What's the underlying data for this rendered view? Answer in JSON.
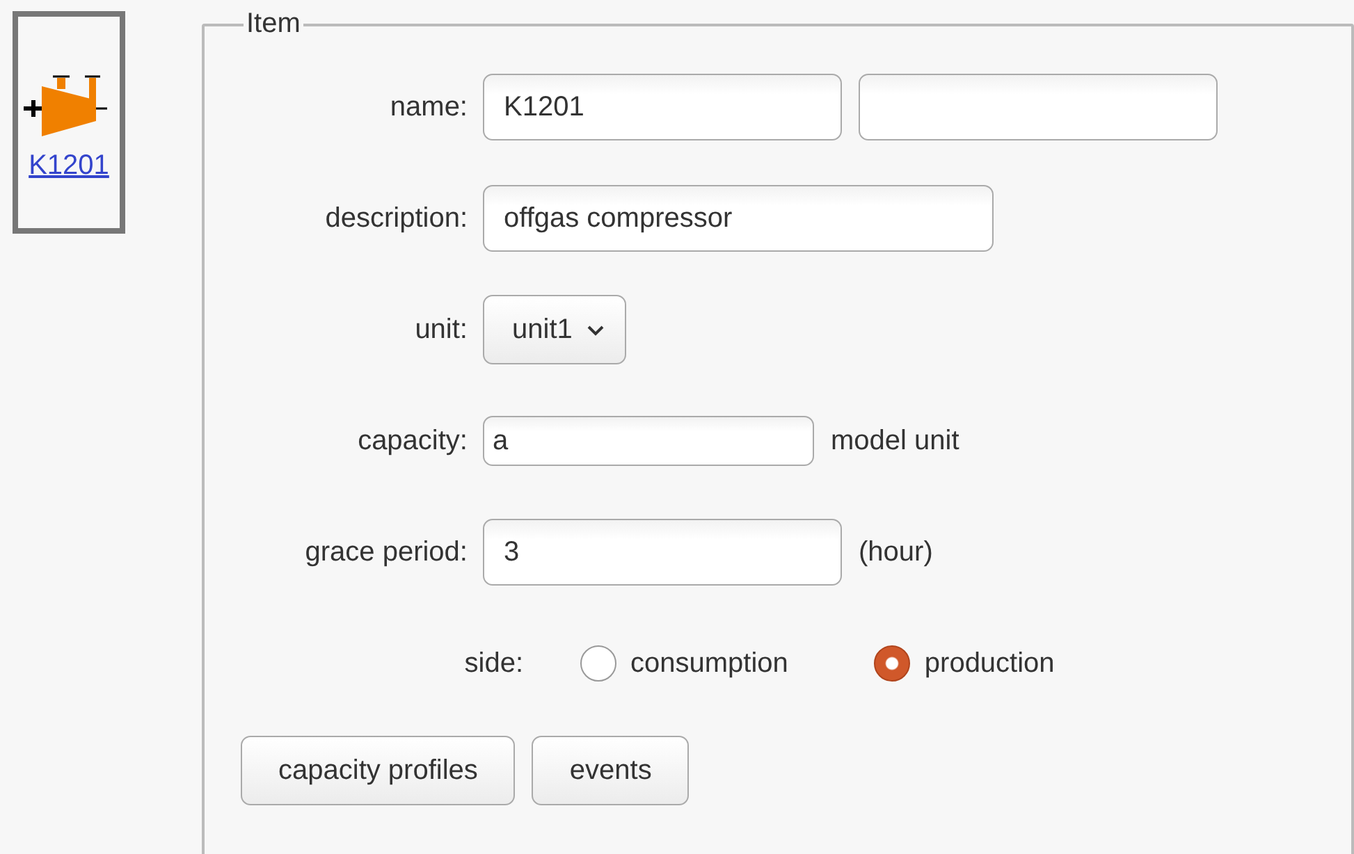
{
  "item_card": {
    "label": "K1201"
  },
  "fieldset": {
    "legend": "Item"
  },
  "fields": [
    {
      "kind": "text_pair",
      "label": "name:",
      "value": "K1201"
    },
    {
      "kind": "text",
      "label": "description:",
      "value": "offgas compressor"
    },
    {
      "kind": "select",
      "label": "unit:",
      "value": "unit1"
    },
    {
      "kind": "text",
      "label": "capacity:",
      "value": "a",
      "suffix": "model unit"
    },
    {
      "kind": "text",
      "label": "grace period:",
      "value": "3",
      "suffix": "(hour)"
    },
    {
      "kind": "radio",
      "label": "side:",
      "options": [
        {
          "label": "consumption",
          "selected": false
        },
        {
          "label": "production",
          "selected": true
        }
      ]
    }
  ],
  "buttons": [
    "capacity profiles",
    "events"
  ]
}
